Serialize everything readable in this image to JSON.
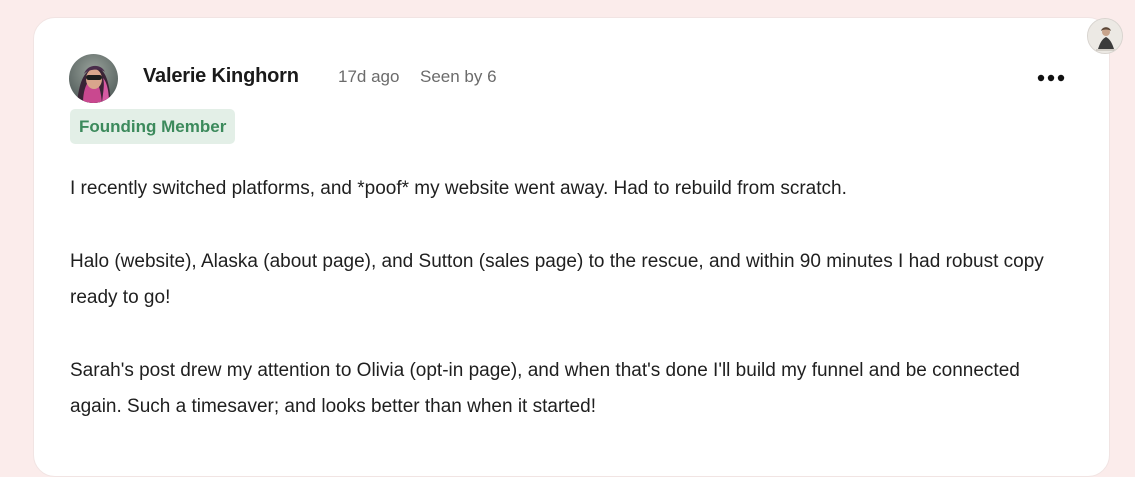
{
  "post": {
    "author_name": "Valerie Kinghorn",
    "time_ago": "17d ago",
    "seen_by": "Seen by 6",
    "badge": "Founding Member",
    "paragraphs": [
      "I recently switched platforms, and *poof* my website went away. Had to rebuild from scratch.",
      "Halo (website), Alaska (about page), and Sutton (sales page) to the rescue, and within 90 minutes I had robust copy ready to go!",
      "Sarah's post drew my attention to Olivia (opt-in page), and when that's done I'll build my funnel and be connected again. Such a timesaver; and looks better than when it started!"
    ]
  },
  "icons": {
    "more_menu": "more-horizontal-icon",
    "author_avatar": "avatar",
    "corner_avatar": "user-avatar"
  },
  "colors": {
    "page_background": "#fbeceb",
    "card_background": "#ffffff",
    "badge_background": "#e3efe7",
    "badge_text": "#3c8a5c",
    "muted_text": "#6b6b6b"
  }
}
